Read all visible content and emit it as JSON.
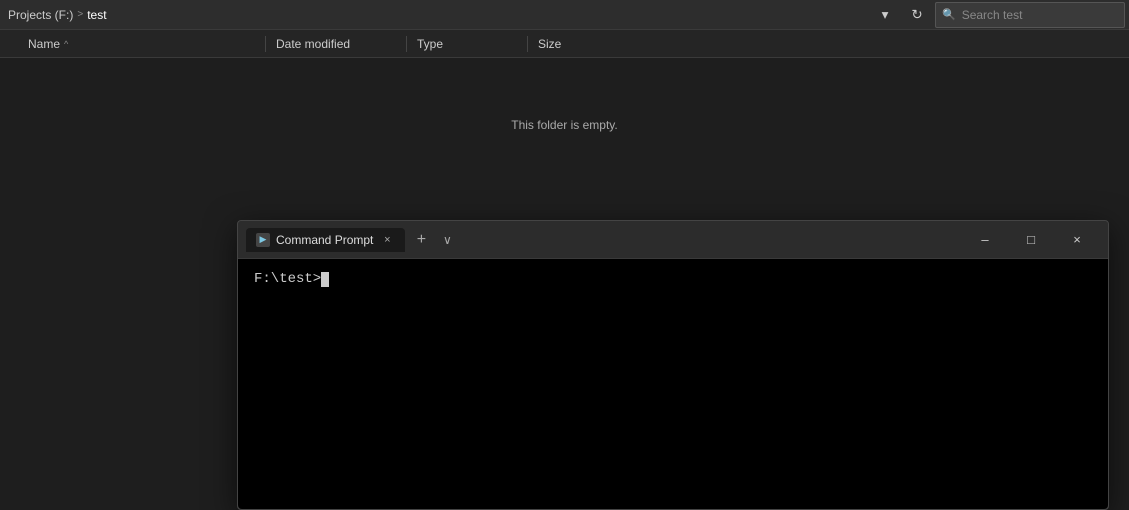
{
  "addressBar": {
    "breadcrumb": {
      "parent": "Projects (F:)",
      "separator": ">",
      "current": "test"
    },
    "dropdownBtn": "▾",
    "refreshBtn": "↻",
    "searchPlaceholder": "Search test"
  },
  "fileList": {
    "columns": {
      "name": "Name",
      "sortArrow": "^",
      "dateModified": "Date modified",
      "type": "Type",
      "size": "Size"
    },
    "emptyMessage": "This folder is empty."
  },
  "terminal": {
    "tabIcon": "⌘",
    "tabLabel": "Command Prompt",
    "tabCloseLabel": "×",
    "newTabLabel": "+",
    "dropdownLabel": "∨",
    "minimizeLabel": "–",
    "maximizeLabel": "□",
    "closeLabel": "×",
    "prompt": "F:\\test>"
  }
}
